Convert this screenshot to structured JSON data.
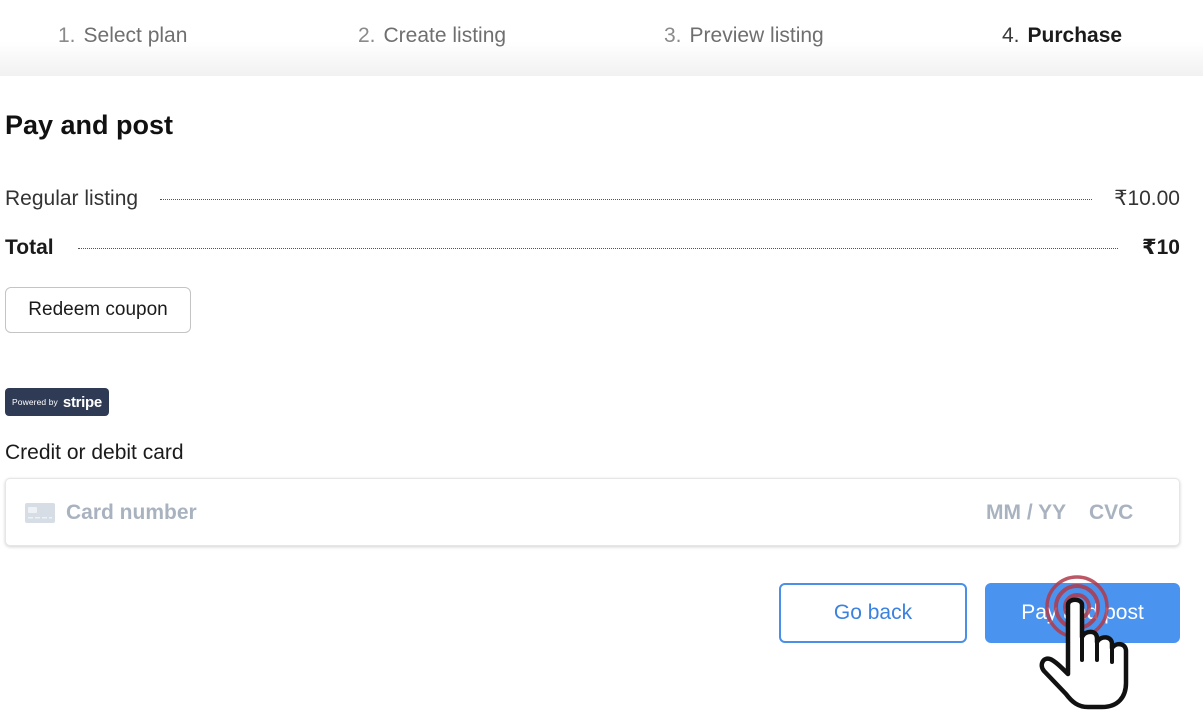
{
  "steps": [
    {
      "num": "1.",
      "label": "Select plan"
    },
    {
      "num": "2.",
      "label": "Create listing"
    },
    {
      "num": "3.",
      "label": "Preview listing"
    },
    {
      "num": "4.",
      "label": "Purchase"
    }
  ],
  "active_step_index": 3,
  "page_title": "Pay and post",
  "summary": {
    "line_label": "Regular listing",
    "line_amount": "₹10.00",
    "total_label": "Total",
    "total_amount": "₹10"
  },
  "coupon_button": "Redeem coupon",
  "stripe_badge": {
    "powered_by": "Powered by",
    "brand": "stripe"
  },
  "card": {
    "label": "Credit or debit card",
    "number_placeholder": "Card number",
    "expiry_placeholder": "MM / YY",
    "cvc_placeholder": "CVC",
    "icon": "credit-card-icon"
  },
  "actions": {
    "back_label": "Go back",
    "pay_label": "Pay and post"
  },
  "colors": {
    "accent": "#4a94f0",
    "stripe_badge_bg": "#2f3a55",
    "placeholder": "#a9b3c0"
  },
  "cursor_icon": "pointing-hand-click-icon"
}
